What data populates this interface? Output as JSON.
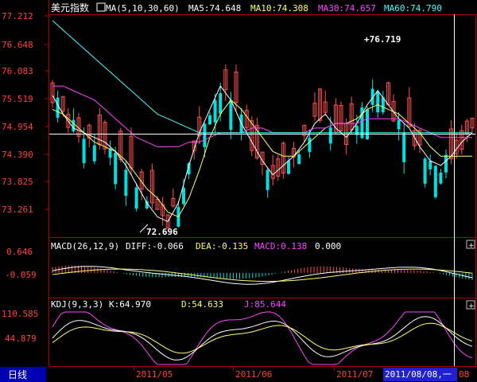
{
  "header": {
    "title": "美元指数",
    "ma_label": "MA(5,10,30,60)",
    "ma5": "MA5:74.648",
    "ma10": "MA10:74.308",
    "ma30": "MA30:74.657",
    "ma60": "MA60:74.790"
  },
  "price_panel": {
    "y_ticks": [
      "77.212",
      "76.648",
      "76.083",
      "75.519",
      "74.954",
      "74.390",
      "73.825",
      "73.261"
    ],
    "high_label": "76.719",
    "low_label": "72.696"
  },
  "macd_panel": {
    "label": "MACD(26,12,9)",
    "diff": "DIFF:-0.066",
    "dea": "DEA:-0.135",
    "macd": "MACD:0.138",
    "extra": "0.000",
    "y_ticks": [
      "0.646",
      "-0.059"
    ]
  },
  "kdj_panel": {
    "label": "KDJ(9,3,3)",
    "k": "K:64.970",
    "d": "D:54.633",
    "j": "J:85.644",
    "y_ticks": [
      "110.585",
      "44.879"
    ]
  },
  "bottom_bar": {
    "period_tab": "日线",
    "dates": [
      "2011/05",
      "2011/06",
      "2011/07"
    ],
    "cursor_date": "2011/08/08,一",
    "cursor_tail": "08"
  },
  "colors": {
    "up": "#ff5050",
    "down": "#00e0e0",
    "ma5": "#ffffff",
    "ma10": "#ffff66",
    "ma30": "#ff44ff",
    "ma60": "#44ffff",
    "frame": "#b00000"
  },
  "chart_data": [
    {
      "type": "line",
      "title": "美元指数",
      "series": [
        {
          "name": "MA5",
          "values": [
            75.6,
            75.2,
            74.9,
            74.8,
            74.7,
            74.6,
            74.4,
            74.1,
            73.7,
            73.3,
            73.0,
            72.9,
            73.3,
            74.1,
            74.8,
            75.3,
            75.8,
            75.5,
            75.0,
            74.6,
            74.2,
            73.9,
            74.1,
            74.3,
            74.6,
            75.0,
            75.2,
            74.9,
            74.7,
            75.0,
            75.4,
            75.7,
            75.4,
            75.1,
            74.9,
            74.5,
            74.2,
            74.1,
            74.3,
            74.6,
            74.8
          ]
        },
        {
          "name": "MA10",
          "values": [
            75.3,
            75.2,
            75.0,
            74.8,
            74.6,
            74.5,
            74.4,
            74.2,
            73.9,
            73.6,
            73.4,
            73.1,
            73.0,
            73.4,
            74.0,
            74.7,
            75.2,
            75.5,
            75.3,
            75.0,
            74.7,
            74.4,
            74.3,
            74.3,
            74.5,
            74.7,
            74.9,
            75.0,
            75.0,
            75.1,
            75.3,
            75.4,
            75.3,
            75.2,
            75.0,
            74.8,
            74.5,
            74.3,
            74.3,
            74.3,
            74.3
          ]
        },
        {
          "name": "MA30",
          "values": [
            75.8,
            75.8,
            75.7,
            75.6,
            75.5,
            75.3,
            75.1,
            74.9,
            74.7,
            74.6,
            74.5,
            74.5,
            74.5,
            74.6,
            74.6,
            74.7,
            74.8,
            74.8,
            74.8,
            74.9,
            74.9,
            74.8,
            74.8,
            74.8,
            74.8,
            74.9,
            74.9,
            75.0,
            75.0,
            75.0,
            75.1,
            75.1,
            75.1,
            75.1,
            75.0,
            74.9,
            74.8,
            74.7,
            74.7,
            74.7,
            74.7
          ]
        },
        {
          "name": "MA60",
          "values": [
            77.2,
            77.0,
            76.8,
            76.6,
            76.4,
            76.2,
            76.0,
            75.8,
            75.6,
            75.4,
            75.2,
            75.1,
            75.0,
            74.9,
            74.8,
            74.8,
            74.8,
            74.8,
            74.8,
            74.8,
            74.8,
            74.8,
            74.8,
            74.8,
            74.8,
            74.8,
            74.8,
            74.8,
            74.8,
            74.8,
            74.8,
            74.8,
            74.8,
            74.8,
            74.8,
            74.8,
            74.8,
            74.8,
            74.8,
            74.8,
            74.8
          ]
        }
      ],
      "ylim": [
        72.6,
        77.3
      ]
    }
  ]
}
